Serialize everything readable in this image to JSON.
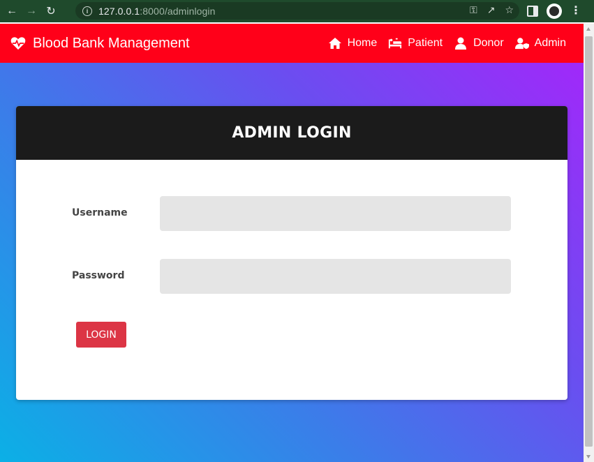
{
  "browser": {
    "url_host": "127.0.0.1",
    "url_path": ":8000/adminlogin",
    "icons": [
      "back-icon",
      "forward-icon",
      "reload-icon",
      "info-icon",
      "key-icon",
      "share-icon",
      "star-icon",
      "side-panel-icon",
      "profile-icon",
      "menu-icon"
    ]
  },
  "navbar": {
    "brand": "Blood Bank Management",
    "links": [
      {
        "label": "Home",
        "icon": "home-icon"
      },
      {
        "label": "Patient",
        "icon": "patient-icon"
      },
      {
        "label": "Donor",
        "icon": "donor-icon"
      },
      {
        "label": "Admin",
        "icon": "admin-icon"
      }
    ],
    "background": "#ff0019"
  },
  "login_card": {
    "title": "ADMIN LOGIN",
    "username_label": "Username",
    "username_value": "",
    "password_label": "Password",
    "password_value": "",
    "submit_label": "LOGIN",
    "submit_color": "#dc3545"
  }
}
